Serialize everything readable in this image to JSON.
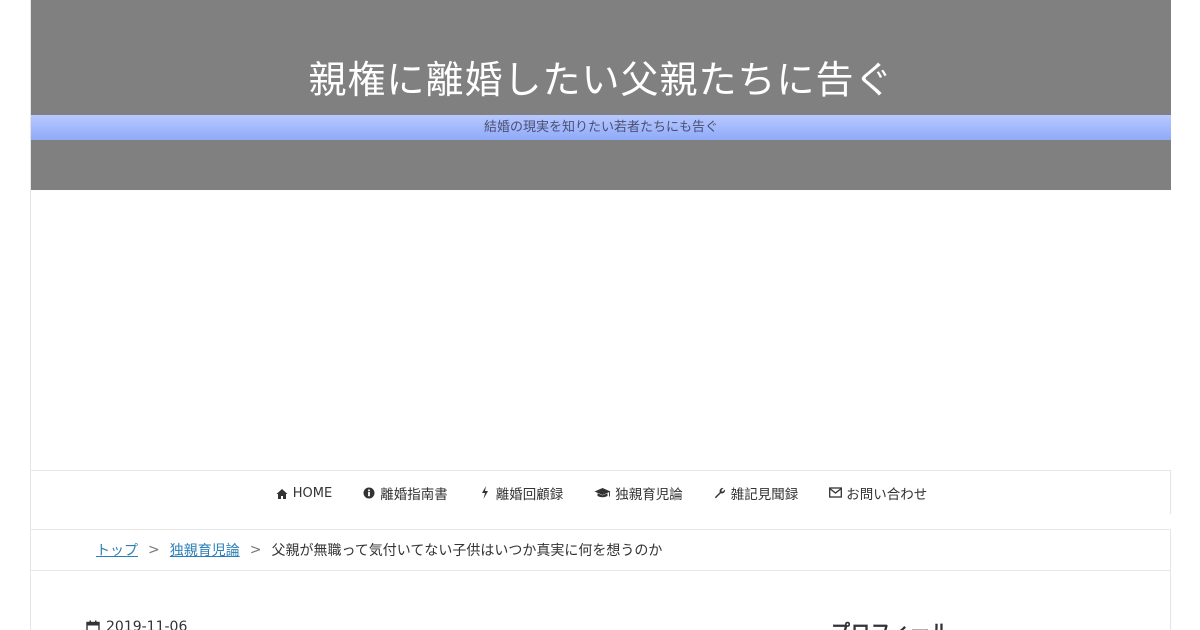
{
  "header": {
    "site_title": "親権に離婚したい父親たちに告ぐ",
    "tagline": "結婚の現実を知りたい若者たちにも告ぐ",
    "background_color": "#808080",
    "tagline_bar_color": "#9bb4fb"
  },
  "nav": {
    "items": [
      {
        "label": "HOME",
        "icon": "home-icon"
      },
      {
        "label": "離婚指南書",
        "icon": "info-circle-icon"
      },
      {
        "label": "離婚回顧録",
        "icon": "bolt-icon"
      },
      {
        "label": "独親育児論",
        "icon": "graduation-cap-icon"
      },
      {
        "label": "雑記見聞録",
        "icon": "wrench-icon"
      },
      {
        "label": "お問い合わせ",
        "icon": "envelope-icon"
      }
    ]
  },
  "breadcrumb": {
    "items": [
      {
        "label": "トップ"
      },
      {
        "label": "独親育児論"
      }
    ],
    "separator": ">",
    "current": "父親が無職って気付いてない子供はいつか真実に何を想うのか"
  },
  "post": {
    "date": "2019-11-06",
    "date_icon": "calendar-icon"
  },
  "sidebar": {
    "heading": "プロフィール"
  },
  "colors": {
    "link": "#2a7fb6",
    "text": "#333333"
  }
}
